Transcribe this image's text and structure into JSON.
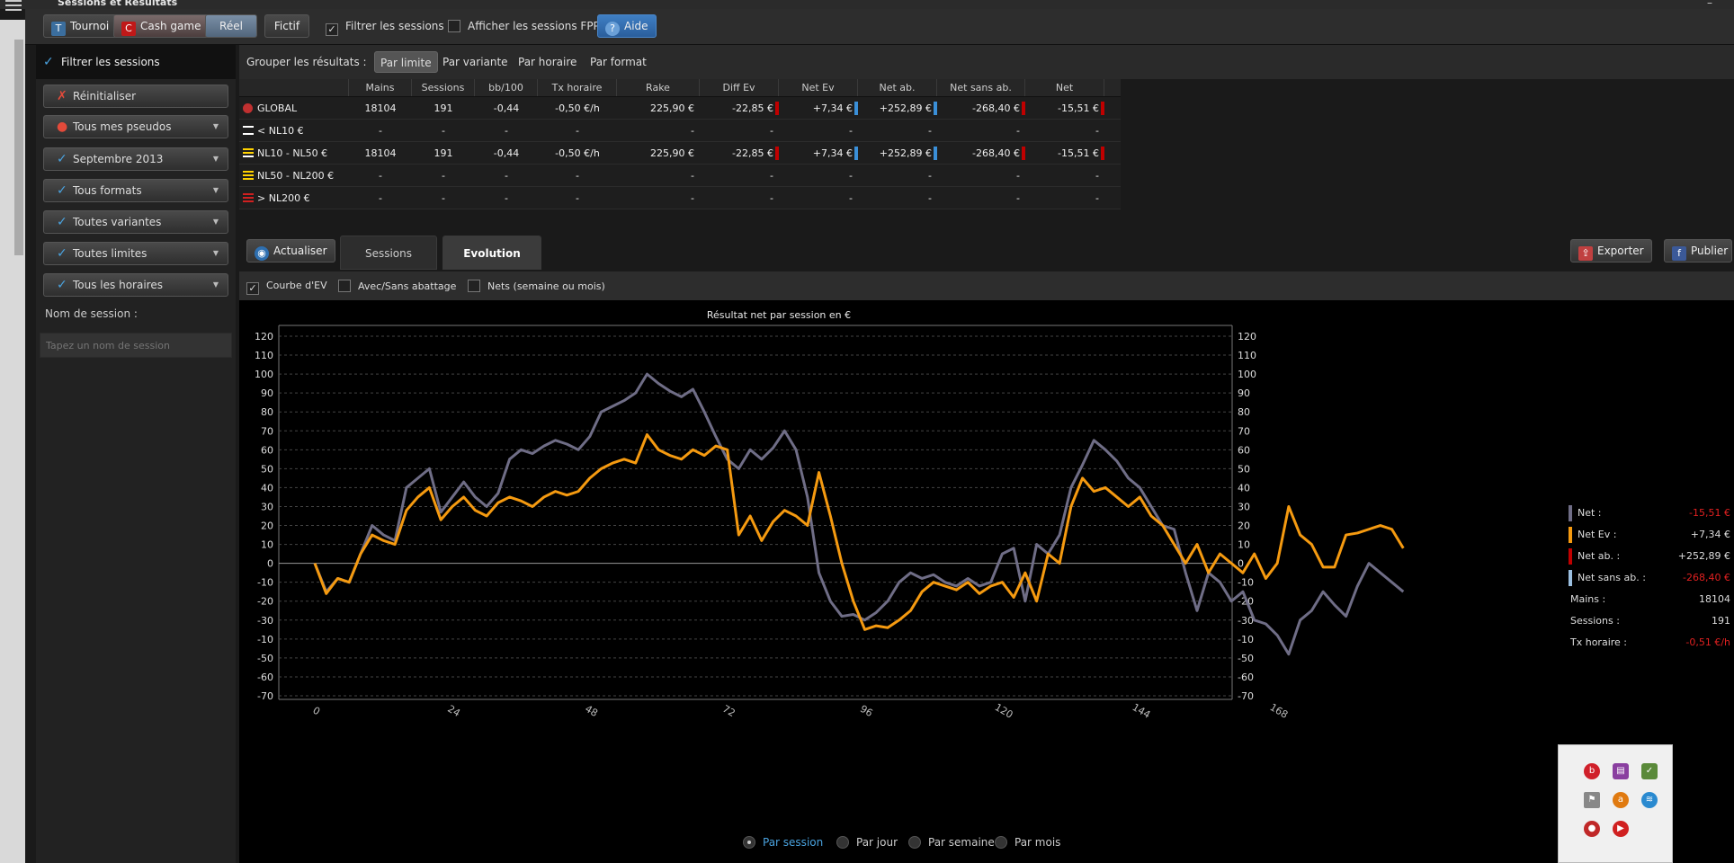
{
  "window": {
    "title": "Sessions et Résultats"
  },
  "toolbar": {
    "tournoi": "Tournoi",
    "cashgame": "Cash game",
    "reel": "Réel",
    "fictif": "Fictif",
    "filter_label": "Filtrer les sessions",
    "fpp_label": "Afficher les sessions FPP",
    "aide": "Aide"
  },
  "sidebar": {
    "filter_header": "Filtrer les sessions",
    "reset": "Réinitialiser",
    "dropdowns": [
      "Tous mes pseudos",
      "Septembre 2013",
      "Tous formats",
      "Toutes variantes",
      "Toutes limites",
      "Tous les horaires"
    ],
    "session_label": "Nom de session :",
    "session_placeholder": "Tapez un nom de session"
  },
  "group": {
    "label": "Grouper les résultats :",
    "tabs": [
      "Par limite",
      "Par variante",
      "Par horaire",
      "Par format"
    ],
    "active": "Par limite"
  },
  "table": {
    "headers": [
      "",
      "Mains",
      "Sessions",
      "bb/100",
      "Tx horaire",
      "Rake",
      "Diff Ev",
      "Net Ev",
      "Net ab.",
      "Net sans ab.",
      "Net"
    ],
    "rows": [
      {
        "name": "GLOBAL",
        "cells": [
          "18104",
          "191",
          "-0,44",
          "-0,50 €/h",
          "225,90 €",
          "-22,85 €",
          "+7,34 €",
          "+252,89 €",
          "-268,40 €",
          "-15,51 €"
        ]
      },
      {
        "name": "< NL10 €",
        "cells": [
          "-",
          "-",
          "-",
          "-",
          "-",
          "-",
          "-",
          "-",
          "-",
          "-"
        ]
      },
      {
        "name": "NL10 - NL50 €",
        "cells": [
          "18104",
          "191",
          "-0,44",
          "-0,50 €/h",
          "225,90 €",
          "-22,85 €",
          "+7,34 €",
          "+252,89 €",
          "-268,40 €",
          "-15,51 €"
        ]
      },
      {
        "name": "NL50 - NL200 €",
        "cells": [
          "-",
          "-",
          "-",
          "-",
          "-",
          "-",
          "-",
          "-",
          "-",
          "-"
        ]
      },
      {
        "name": "> NL200 €",
        "cells": [
          "-",
          "-",
          "-",
          "-",
          "-",
          "-",
          "-",
          "-",
          "-",
          "-"
        ]
      }
    ]
  },
  "view": {
    "actualiser": "Actualiser",
    "sessions": "Sessions",
    "evolution": "Evolution",
    "exporter": "Exporter",
    "publier": "Publier"
  },
  "options": {
    "ev_curve": "Courbe d'EV",
    "abattage": "Avec/Sans abattage",
    "nets": "Nets (semaine ou mois)"
  },
  "legend": {
    "net_label": "Net :",
    "net_value": "-15,51 €",
    "netev_label": "Net Ev :",
    "netev_value": "+7,34 €",
    "netab_label": "Net ab. :",
    "netab_value": "+252,89 €",
    "netsans_label": "Net sans ab. :",
    "netsans_value": "-268,40 €",
    "mains_label": "Mains :",
    "mains_value": "18104",
    "sessions_label": "Sessions :",
    "sessions_value": "191",
    "tx_label": "Tx horaire :",
    "tx_value": "-0,51 €/h"
  },
  "radios": {
    "options": [
      "Par session",
      "Par jour",
      "Par semaine",
      "Par mois"
    ],
    "active": "Par session"
  },
  "colors": {
    "net": "#6f6d86",
    "netev": "#f59a10",
    "netab": "#c00000",
    "netsans": "#9bbfe0",
    "accent": "#4aa3e0"
  },
  "chart_data": {
    "type": "line",
    "title": "Résultat net par session en €",
    "xlabel": "",
    "ylabel": "",
    "xlim": [
      0,
      191
    ],
    "ylim": [
      -70,
      120
    ],
    "xticks": [
      0,
      24,
      48,
      72,
      96,
      120,
      144,
      168
    ],
    "yticks": [
      120,
      110,
      100,
      90,
      80,
      70,
      60,
      50,
      40,
      30,
      20,
      10,
      0,
      -10,
      -20,
      -30,
      -40,
      -50,
      -60,
      -70
    ],
    "ytick_labels": [
      "120",
      "110",
      "100",
      "90",
      "80",
      "70",
      "60",
      "50",
      "40",
      "30",
      "20",
      "10",
      "0",
      "-10",
      "-20",
      "-30",
      "-10",
      "-50",
      "-60",
      "-70"
    ],
    "grid": true,
    "series": [
      {
        "name": "Net",
        "color": "#6f6d86",
        "x": [
          0,
          2,
          4,
          6,
          8,
          10,
          12,
          14,
          16,
          18,
          20,
          22,
          24,
          26,
          28,
          30,
          32,
          34,
          36,
          38,
          40,
          42,
          44,
          46,
          48,
          50,
          52,
          54,
          56,
          58,
          60,
          62,
          64,
          66,
          68,
          70,
          72,
          74,
          76,
          78,
          80,
          82,
          84,
          86,
          88,
          90,
          92,
          94,
          96,
          98,
          100,
          102,
          104,
          106,
          108,
          110,
          112,
          114,
          116,
          118,
          120,
          122,
          124,
          126,
          128,
          130,
          132,
          134,
          136,
          138,
          140,
          142,
          144,
          146,
          148,
          150,
          152,
          154,
          156,
          158,
          160,
          162,
          164,
          166,
          168,
          170,
          172,
          174,
          176,
          178,
          180,
          182,
          184,
          186,
          188,
          190
        ],
        "y": [
          0,
          -15,
          -8,
          -10,
          5,
          20,
          15,
          12,
          40,
          45,
          50,
          27,
          35,
          43,
          35,
          30,
          37,
          55,
          60,
          58,
          62,
          65,
          63,
          60,
          67,
          80,
          83,
          86,
          90,
          100,
          95,
          91,
          88,
          92,
          80,
          67,
          55,
          50,
          60,
          55,
          61,
          70,
          60,
          35,
          -5,
          -20,
          -28,
          -27,
          -30,
          -26,
          -20,
          -10,
          -5,
          -8,
          -6,
          -10,
          -12,
          -8,
          -12,
          -10,
          5,
          8,
          -20,
          10,
          5,
          15,
          40,
          52,
          65,
          60,
          54,
          45,
          40,
          30,
          20,
          18,
          -5,
          -25,
          -5,
          -10,
          -20,
          -15,
          -30,
          -32,
          -38,
          -48,
          -30,
          -25,
          -15,
          -22,
          -28,
          -12,
          0,
          -5,
          -10,
          -15
        ]
      },
      {
        "name": "Net Ev",
        "color": "#f59a10",
        "x": [
          0,
          2,
          4,
          6,
          8,
          10,
          12,
          14,
          16,
          18,
          20,
          22,
          24,
          26,
          28,
          30,
          32,
          34,
          36,
          38,
          40,
          42,
          44,
          46,
          48,
          50,
          52,
          54,
          56,
          58,
          60,
          62,
          64,
          66,
          68,
          70,
          72,
          74,
          76,
          78,
          80,
          82,
          84,
          86,
          88,
          90,
          92,
          94,
          96,
          98,
          100,
          102,
          104,
          106,
          108,
          110,
          112,
          114,
          116,
          118,
          120,
          122,
          124,
          126,
          128,
          130,
          132,
          134,
          136,
          138,
          140,
          142,
          144,
          146,
          148,
          150,
          152,
          154,
          156,
          158,
          160,
          162,
          164,
          166,
          168,
          170,
          172,
          174,
          176,
          178,
          180,
          182,
          184,
          186,
          188,
          190
        ],
        "y": [
          0,
          -16,
          -8,
          -10,
          5,
          15,
          12,
          10,
          28,
          35,
          40,
          23,
          30,
          35,
          28,
          25,
          32,
          35,
          33,
          30,
          35,
          38,
          36,
          38,
          45,
          50,
          53,
          55,
          53,
          68,
          60,
          57,
          55,
          60,
          57,
          62,
          60,
          15,
          25,
          12,
          22,
          28,
          25,
          20,
          48,
          25,
          0,
          -20,
          -35,
          -33,
          -34,
          -30,
          -25,
          -15,
          -10,
          -12,
          -14,
          -10,
          -16,
          -12,
          -10,
          -18,
          -5,
          -20,
          5,
          0,
          30,
          45,
          38,
          40,
          35,
          30,
          35,
          25,
          20,
          10,
          0,
          10,
          -5,
          5,
          0,
          -5,
          5,
          -8,
          0,
          30,
          15,
          10,
          -2,
          -2,
          15,
          16,
          18,
          20,
          18,
          8
        ]
      }
    ]
  }
}
